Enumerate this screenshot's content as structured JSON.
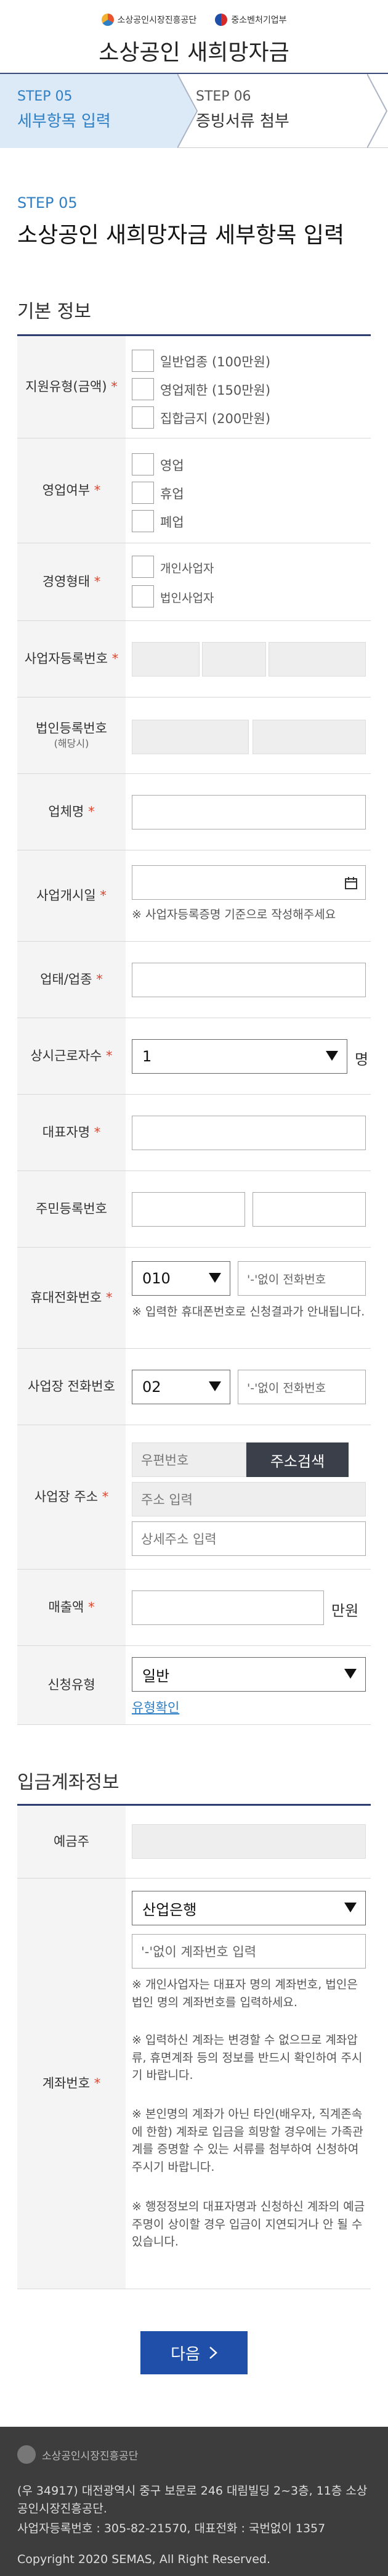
{
  "header": {
    "org1": "소상공인시장진흥공단",
    "org2": "중소벤처기업부",
    "title": "소상공인 새희망자금"
  },
  "steps": [
    {
      "num": "STEP 05",
      "label": "세부항목 입력"
    },
    {
      "num": "STEP 06",
      "label": "증빙서류 첨부"
    }
  ],
  "section": {
    "step": "STEP 05",
    "title": "소상공인 새희망자금 세부항목 입력"
  },
  "basic": {
    "title": "기본 정보",
    "support_type": {
      "label": "지원유형(금액)",
      "options": [
        "일반업종 (100만원)",
        "영업제한 (150만원)",
        "집합금지 (200만원)"
      ]
    },
    "business_status": {
      "label": "영업여부",
      "options": [
        "영업",
        "휴업",
        "폐업"
      ]
    },
    "business_form": {
      "label": "경영형태",
      "options": [
        "개인사업자",
        "법인사업자"
      ]
    },
    "biz_reg_no": {
      "label": "사업자등록번호"
    },
    "corp_reg_no": {
      "label": "법인등록번호",
      "sub": "(해당시)"
    },
    "company_name": {
      "label": "업체명"
    },
    "open_date": {
      "label": "사업개시일",
      "note": "※ 사업자등록증명 기준으로 작성해주세요"
    },
    "business_type": {
      "label": "업태/업종"
    },
    "employees": {
      "label": "상시근로자수",
      "value": "1",
      "unit": "명"
    },
    "ceo_name": {
      "label": "대표자명"
    },
    "resident_no": {
      "label": "주민등록번호"
    },
    "mobile": {
      "label": "휴대전화번호",
      "prefix": "010",
      "placeholder": "'-'없이 전화번호",
      "note": "※ 입력한 휴대폰번호로 신청결과가 안내됩니다."
    },
    "biz_phone": {
      "label": "사업장 전화번호",
      "prefix": "02",
      "placeholder": "'-'없이 전화번호"
    },
    "address": {
      "label": "사업장 주소",
      "zip_placeholder": "우편번호",
      "search_button": "주소검색",
      "addr_placeholder": "주소 입력",
      "detail_placeholder": "상세주소 입력"
    },
    "sales": {
      "label": "매출액",
      "unit": "만원"
    },
    "apply_type": {
      "label": "신청유형",
      "value": "일반",
      "link": "유형확인"
    }
  },
  "account": {
    "title": "입금계좌정보",
    "holder": {
      "label": "예금주"
    },
    "number": {
      "label": "계좌번호",
      "bank": "산업은행",
      "placeholder": "'-'없이 계좌번호 입력",
      "notes": [
        "※ 개인사업자는 대표자 명의 계좌번호, 법인은 법인 명의 계좌번호를 입력하세요.",
        "※ 입력하신 계좌는 변경할 수 없으므로 계좌압류, 휴면계좌 등의 정보를 반드시 확인하여 주시기 바랍니다.",
        "※ 본인명의 계좌가 아닌 타인(배우자, 직계존속에 한함) 계좌로 입금을 희망할 경우에는 가족관계를 증명할 수 있는 서류를 첨부하여 신청하여 주시기 바랍니다.",
        "※ 행정정보의 대표자명과 신청하신 계좌의 예금주명이 상이할 경우 입금이 지연되거나 안 될 수 있습니다."
      ]
    }
  },
  "next_button": "다음",
  "footer": {
    "org": "소상공인시장진흥공단",
    "address": "(우 34917) 대전광역시 중구 보문로 246 대림빌딩 2~3층, 11층 소상공인시장진흥공단.",
    "biz_info": "사업자등록번호 : 305-82-21570, 대표전화 : 국번없이 1357",
    "copyright": "Copyright 2020 SEMAS, All Right Reserved."
  },
  "colors": {
    "accent": "#2f7fc4",
    "navy": "#2d3d70",
    "required": "#e0432b",
    "button": "#1f4fa8",
    "footer": "#3d3d3d"
  }
}
